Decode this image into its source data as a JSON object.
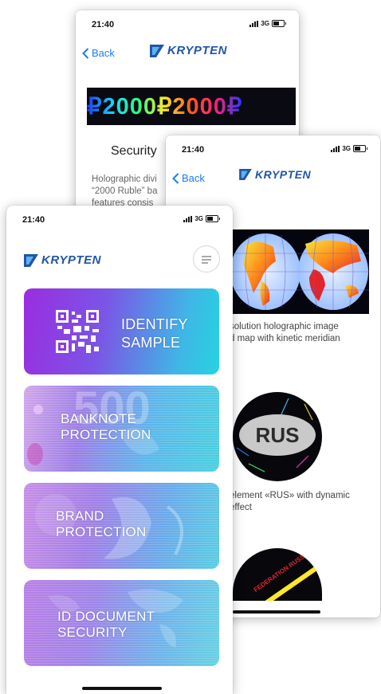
{
  "status": {
    "time": "21:40",
    "network": "3G"
  },
  "brand": {
    "name": "KRYPTEN"
  },
  "nav": {
    "back_label": "Back"
  },
  "detail_screen": {
    "hologram_text": "₽2000₽2000₽",
    "title": "Security",
    "body_lines": [
      "Holographic divi",
      "“2000 Ruble” ba",
      "features consis"
    ]
  },
  "elements_screen": {
    "captions": [
      [
        "solution holographic image",
        "d map with kinetic meridian"
      ],
      [
        "element «RUS» with dynamic",
        "effect"
      ]
    ],
    "rus_label": "RUS",
    "seal_text": "FEDERATION RUSSIAN"
  },
  "home_screen": {
    "cards": [
      {
        "label_1": "IDENTIFY",
        "label_2": "SAMPLE"
      },
      {
        "label_1": "BANKNOTE",
        "label_2": "PROTECTION"
      },
      {
        "label_1": "BRAND",
        "label_2": "PROTECTION"
      },
      {
        "label_1": "ID DOCUMENT",
        "label_2": "SECURITY"
      }
    ],
    "menu_icon": "hamburger-icon",
    "qr_icon": "qr-code-icon"
  },
  "colors": {
    "accent": "#1a7cf5",
    "brand": "#1f56a8"
  }
}
